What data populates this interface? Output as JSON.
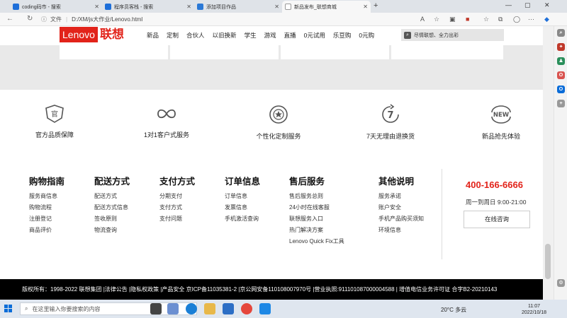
{
  "browser": {
    "tabs": [
      {
        "title": "coding码市 - 搜索",
        "color": "#1e6fd9"
      },
      {
        "title": "程序员客栈 - 搜索",
        "color": "#1e6fd9"
      },
      {
        "title": "添加项目作品",
        "color": "#2b79d6"
      },
      {
        "title": "新品发布_联想商城",
        "color": "#999999"
      }
    ],
    "new_tab": "+",
    "address_label": "文件",
    "url": "D:/XM/js大作业/Lenovo.html"
  },
  "site": {
    "logo_en": "Lenovo",
    "logo_cn": "联想",
    "nav": [
      "新品",
      "定制",
      "合伙人",
      "以旧换新",
      "学生",
      "游戏",
      "直播",
      "0元试用",
      "乐豆购",
      "0元购"
    ],
    "search_placeholder": "尽情联想、全力出彩"
  },
  "services": [
    {
      "label": "官方品质保障",
      "icon": "shield-icon"
    },
    {
      "label": "1对1客户式服务",
      "icon": "loop-icon"
    },
    {
      "label": "个性化定制服务",
      "icon": "star-badge-icon"
    },
    {
      "label": "7天无理由退换货",
      "icon": "return-7-icon"
    },
    {
      "label": "新品抢先体验",
      "icon": "new-icon"
    }
  ],
  "footer": {
    "columns": [
      {
        "title": "购物指南",
        "links": [
          "服务商信息",
          "购物流程",
          "注册登记",
          "商品评价"
        ]
      },
      {
        "title": "配送方式",
        "links": [
          "配送方式",
          "配送方式信息",
          "签收原则",
          "物流查询"
        ]
      },
      {
        "title": "支付方式",
        "links": [
          "分期支付",
          "支付方式",
          "支付问题"
        ]
      },
      {
        "title": "订单信息",
        "links": [
          "订单信息",
          "发票信息",
          "手机激活查询"
        ]
      },
      {
        "title": "售后服务",
        "links": [
          "售后服务总则",
          "24小时在线客服",
          "联想服务入口",
          "热门解决方案",
          "Lenovo Quick Fix工具"
        ]
      },
      {
        "title": "其他说明",
        "links": [
          "服务承诺",
          "账户安全",
          "手机产品购买须知",
          "环境信息"
        ]
      }
    ],
    "phone": "400-166-6666",
    "hours": "周一到周日  9:00-21:00",
    "consult_button": "在线咨询",
    "copyright": "版权所有：1998-2022 联想集团 |法律公告 |隐私权政策 |产品安全    京ICP备11035381-2 |京公网安备110108007970号 |营业执照:911101087000004588 | 增值电信业务许可证 合字B2-20210143"
  },
  "taskbar": {
    "search_placeholder": "在这里输入你要搜索的内容",
    "weather": "20°C 多云",
    "time": "11:07",
    "date": "2022/10/18"
  }
}
